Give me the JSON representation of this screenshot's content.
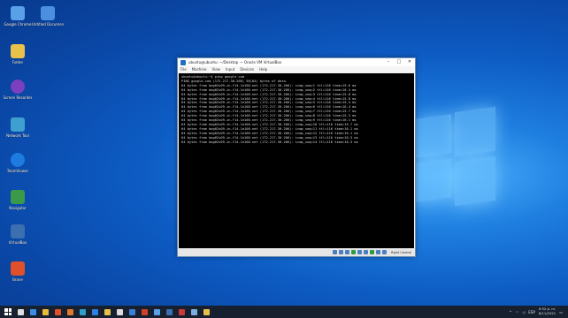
{
  "desktop": {
    "icons": [
      {
        "label": "Google Chrome",
        "icon": "chrome-icon",
        "color": "#5aa0e8"
      },
      {
        "label": "Untitled Document",
        "icon": "document-icon",
        "color": "#4c8fe0"
      },
      {
        "label": "Folder",
        "icon": "folder-icon",
        "color": "#e8c14a"
      },
      {
        "label": "Screen Recorder",
        "icon": "recorder-icon",
        "color": "#7b3fbf"
      },
      {
        "label": "Network Tool",
        "icon": "network-icon",
        "color": "#3fa0d0"
      },
      {
        "label": "TeamViewer",
        "icon": "teamviewer-icon",
        "color": "#1e7be0"
      },
      {
        "label": "Navigator",
        "icon": "navigator-icon",
        "color": "#3a9a4a"
      },
      {
        "label": "VirtualBox",
        "icon": "virtualbox-icon",
        "color": "#3b6fb0"
      },
      {
        "label": "Brave",
        "icon": "brave-icon",
        "color": "#e0502a"
      }
    ]
  },
  "window": {
    "title": "ubuntu@ubuntu: ~/Desktop — Oracle VM VirtualBox",
    "menu": [
      "File",
      "Machine",
      "View",
      "Input",
      "Devices",
      "Help"
    ],
    "console_lines": [
      "ubuntu@ubuntu:~$ ping google.com",
      "PING google.com (172.217.30.206) 56(84) bytes of data.",
      "64 bytes from bog02s09-in-f14.1e100.net (172.217.30.206): icmp_seq=1 ttl=116 time=19.6 ms",
      "64 bytes from bog02s09-in-f14.1e100.net (172.217.30.206): icmp_seq=2 ttl=116 time=16.4 ms",
      "64 bytes from bog02s09-in-f14.1e100.net (172.217.30.206): icmp_seq=3 ttl=116 time=15.8 ms",
      "64 bytes from bog02s09-in-f14.1e100.net (172.217.30.206): icmp_seq=4 ttl=116 time=15.8 ms",
      "64 bytes from bog02s09-in-f14.1e100.net (172.217.30.206): icmp_seq=5 ttl=116 time=15.4 ms",
      "64 bytes from bog02s09-in-f14.1e100.net (172.217.30.206): icmp_seq=6 ttl=116 time=16.4 ms",
      "64 bytes from bog02s09-in-f14.1e100.net (172.217.30.206): icmp_seq=7 ttl=116 time=15.7 ms",
      "64 bytes from bog02s09-in-f14.1e100.net (172.217.30.206): icmp_seq=8 ttl=116 time=15.3 ms",
      "64 bytes from bog02s09-in-f14.1e100.net (172.217.30.206): icmp_seq=9 ttl=116 time=16.1 ms",
      "64 bytes from bog02s09-in-f14.1e100.net (172.217.30.206): icmp_seq=10 ttl=116 time=15.7 ms",
      "64 bytes from bog02s09-in-f14.1e100.net (172.217.30.206): icmp_seq=11 ttl=116 time=16.1 ms",
      "64 bytes from bog02s09-in-f14.1e100.net (172.217.30.206): icmp_seq=12 ttl=116 time=16.1 ms",
      "64 bytes from bog02s09-in-f14.1e100.net (172.217.30.206): icmp_seq=13 ttl=116 time=16.3 ms",
      "64 bytes from bog02s09-in-f14.1e100.net (172.217.30.206): icmp_seq=14 ttl=116 time=16.3 ms"
    ],
    "status_host": "Right Control"
  },
  "taskbar": {
    "apps": [
      {
        "icon": "search-icon",
        "color": "#e0e0e0"
      },
      {
        "icon": "task-view-icon",
        "color": "#3a8ee6"
      },
      {
        "icon": "chrome-icon",
        "color": "#e9b93a"
      },
      {
        "icon": "brave-icon",
        "color": "#e0502a"
      },
      {
        "icon": "firefox-icon",
        "color": "#e07a2a"
      },
      {
        "icon": "edge-icon",
        "color": "#2fa0c8"
      },
      {
        "icon": "settings-icon",
        "color": "#2f7fe0"
      },
      {
        "icon": "file-explorer-icon",
        "color": "#e8c14a"
      },
      {
        "icon": "terminal-icon",
        "color": "#dcdcdc"
      },
      {
        "icon": "mail-icon",
        "color": "#3c7fd8"
      },
      {
        "icon": "office-icon",
        "color": "#d0402a"
      },
      {
        "icon": "store-icon",
        "color": "#5aa0e8"
      },
      {
        "icon": "virtualbox-icon",
        "color": "#3b6fb0"
      },
      {
        "icon": "photos-icon",
        "color": "#c83a3a"
      },
      {
        "icon": "network-icon",
        "color": "#7ab0e0"
      },
      {
        "icon": "paint-icon",
        "color": "#e8c14a"
      }
    ],
    "language": "ESP",
    "time": "9:52 p. m.",
    "date": "8/11/2021"
  }
}
